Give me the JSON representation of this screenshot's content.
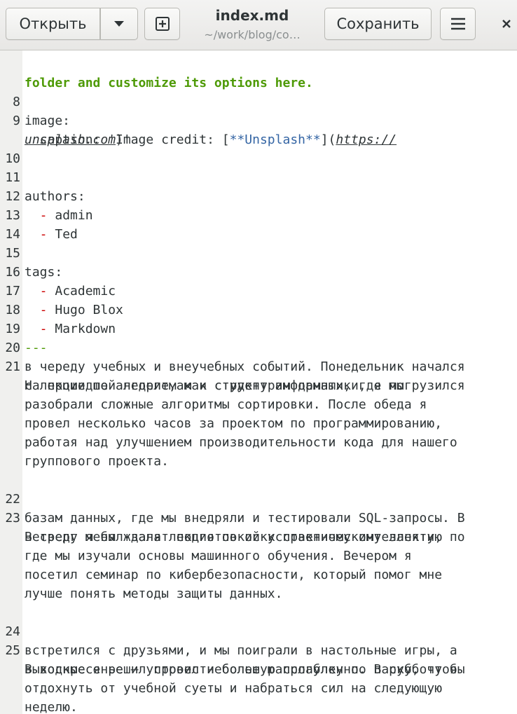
{
  "header": {
    "open_label": "Открыть",
    "save_label": "Сохранить",
    "title": "index.md",
    "subtitle": "~/work/blog/co…",
    "icons": [
      "chevron-down-icon",
      "new-tab-icon",
      "hamburger-menu-icon",
      "close-icon"
    ]
  },
  "editor": {
    "line_numbers": [
      "8",
      "9",
      "10",
      "11",
      "12",
      "13",
      "14",
      "15",
      "16",
      "17",
      "18",
      "19",
      "20",
      "21",
      "22",
      "23",
      "24",
      "25"
    ],
    "comment_tail": "folder and customize its options here.",
    "image_key": "image:",
    "caption_prefix": "  caption: 'Image credit: [",
    "caption_bold_open": "**",
    "caption_link_text": "Unsplash",
    "caption_bold_close": "**",
    "caption_paren_open": "](",
    "caption_url_part1": "https://",
    "caption_url_part2": "unsplash.com",
    "caption_suffix": ")'",
    "authors_key": "authors:",
    "authors": [
      "admin",
      "Ted"
    ],
    "tags_key": "tags:",
    "tags": [
      "Academic",
      "Hugo Blox",
      "Markdown"
    ],
    "front_matter_end": "---",
    "list_dash": "  - ",
    "paragraph1": [
      "На прошедшей неделе, как студент информатики, я погрузился",
      "в череду учебных и внеучебных событий. Понедельник начался",
      "с лекции по алгоритмам и структурам данных, где мы",
      "разобрали сложные алгоритмы сортировки. После обеда я",
      "провел несколько часов за проектом по программированию,",
      "работая над улучшением производительности кода для нашего",
      "группового проекта."
    ],
    "paragraph2": [
      "В среду я был занят подготовкой к практическому занятию по",
      "базам данных, где мы внедряли и тестировали SQL-запросы. В",
      "четверг меня ждала лекция по искусственному интеллекту,",
      "где мы изучали основы машинного обучения. Вечером я",
      "посетил семинар по кибербезопасности, который помог мне",
      "лучше понять методы защиты данных."
    ],
    "paragraph3": [
      "Выходные я решил провести более расслабленно. В субботу я",
      "встретился с друзьями, и мы поиграли в настольные игры, а",
      "в воскресенье — устроил небольшую прогулку по парку, чтобы",
      "отдохнуть от учебной суеты и набраться сил на следующую",
      "неделю."
    ]
  },
  "colors": {
    "comment": "#4e9a06",
    "list_dash": "#cc0000",
    "markdown_emphasis": "#3465a4",
    "text": "#2e3436",
    "gutter_bg": "#f0f0ee"
  }
}
